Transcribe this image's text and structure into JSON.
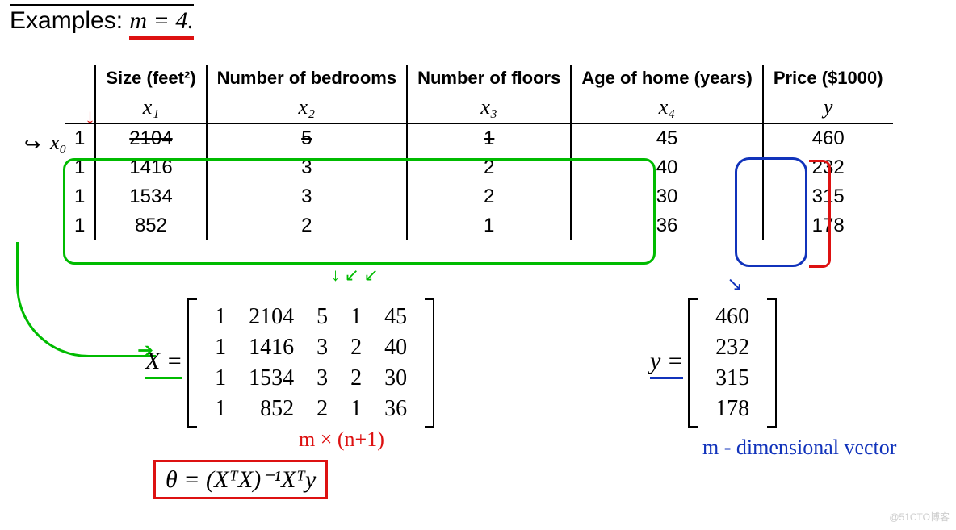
{
  "title_prefix": "Examples:",
  "title_math": "m = 4.",
  "headers": {
    "h0": "",
    "h1": "Size (feet²)",
    "h2": "Number of bedrooms",
    "h3": "Number of floors",
    "h4": "Age of home (years)",
    "h5": "Price ($1000)"
  },
  "vars": {
    "v0": "x₀",
    "v1": "x₁",
    "v2": "x₂",
    "v3": "x₃",
    "v4": "x₄",
    "v5": "y"
  },
  "rows": [
    {
      "c0": "1",
      "c1": "2104",
      "c2": "5",
      "c3": "1",
      "c4": "45",
      "c5": "460"
    },
    {
      "c0": "1",
      "c1": "1416",
      "c2": "3",
      "c3": "2",
      "c4": "40",
      "c5": "232"
    },
    {
      "c0": "1",
      "c1": "1534",
      "c2": "3",
      "c3": "2",
      "c4": "30",
      "c5": "315"
    },
    {
      "c0": "1",
      "c1": "852",
      "c2": "2",
      "c3": "1",
      "c4": "36",
      "c5": "178"
    }
  ],
  "matrixX_label": "X =",
  "matrixX": [
    [
      "1",
      "2104",
      "5",
      "1",
      "45"
    ],
    [
      "1",
      "1416",
      "3",
      "2",
      "40"
    ],
    [
      "1",
      "1534",
      "3",
      "2",
      "30"
    ],
    [
      "1",
      "852",
      "2",
      "1",
      "36"
    ]
  ],
  "vecY_label": "y =",
  "vecY": [
    "460",
    "232",
    "315",
    "178"
  ],
  "note_mxn": "m × (n+1)",
  "note_mdim": "m - dimensional vector",
  "theta_formula": "θ = (XᵀX)⁻¹Xᵀy",
  "watermark": "@51CTO博客",
  "x0_label": "x₀",
  "down_arrow": "↓",
  "curved_arrow_in": "↪",
  "X_arrowhead": "➔",
  "y_arrowhead": "↘",
  "green_small_arrows": "↓   ↙ ↙"
}
